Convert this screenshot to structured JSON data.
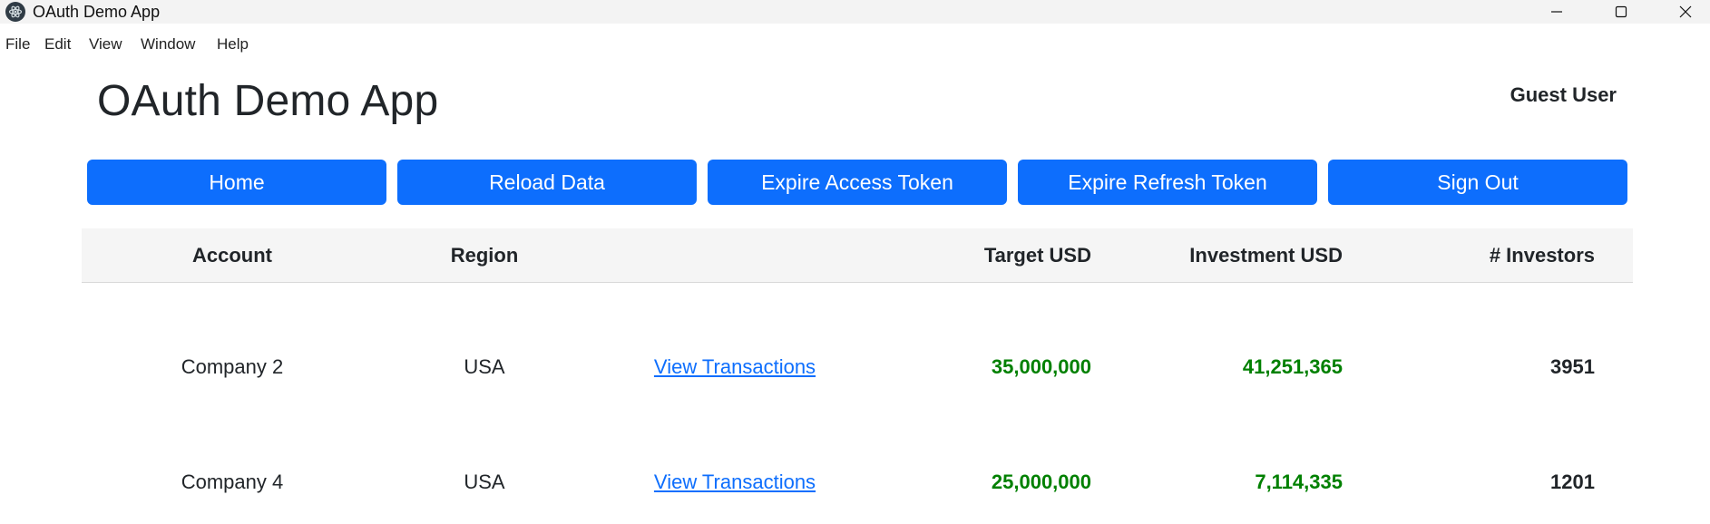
{
  "window": {
    "title": "OAuth Demo App",
    "icon": "electron-app-icon"
  },
  "menu": {
    "items": [
      "File",
      "Edit",
      "View",
      "Window",
      "Help"
    ]
  },
  "header": {
    "title": "OAuth Demo App",
    "user": "Guest User"
  },
  "buttons": {
    "home": "Home",
    "reload": "Reload Data",
    "expire_access": "Expire Access Token",
    "expire_refresh": "Expire Refresh Token",
    "sign_out": "Sign Out"
  },
  "table": {
    "columns": [
      "Account",
      "Region",
      "",
      "Target USD",
      "Investment USD",
      "# Investors"
    ],
    "rows": [
      {
        "account": "Company 2",
        "region": "USA",
        "link": "View Transactions",
        "target": "35,000,000",
        "investment": "41,251,365",
        "investors": "3951"
      },
      {
        "account": "Company 4",
        "region": "USA",
        "link": "View Transactions",
        "target": "25,000,000",
        "investment": "7,114,335",
        "investors": "1201"
      }
    ]
  },
  "colors": {
    "primary": "#0d6efd",
    "money": "#008000",
    "header_bg": "#f5f5f5"
  }
}
